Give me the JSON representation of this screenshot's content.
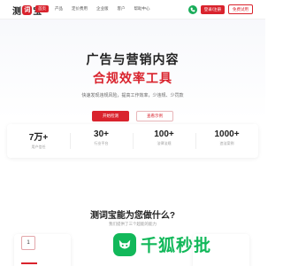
{
  "brand": {
    "logo_left": "测",
    "logo_mark": "词",
    "logo_right": "宝",
    "accent_color": "#d9232d",
    "phone_color": "#1aad5a"
  },
  "nav": {
    "items": [
      {
        "label": "首页",
        "active": true
      },
      {
        "label": "产品"
      },
      {
        "label": "定价费用"
      },
      {
        "label": "企业版"
      },
      {
        "label": "客户"
      },
      {
        "label": "帮助中心"
      }
    ],
    "login_label": "登录/注册",
    "trial_label": "免费试用"
  },
  "hero": {
    "title": "广告与营销内容",
    "title_highlight": "合规效率工具",
    "subtitle": "快速发现违规风险，提高工作效率，少违规、少罚款",
    "primary_button": "开始检测",
    "secondary_button": "查看示例"
  },
  "stats": [
    {
      "value": "7万+",
      "label": "用户信任"
    },
    {
      "value": "30+",
      "label": "行业平台"
    },
    {
      "value": "100+",
      "label": "法律法规"
    },
    {
      "value": "1000+",
      "label": "违法案例"
    }
  ],
  "section": {
    "title": "测词宝能为您做什么?",
    "subtitle": "我们提供了三个超能的能力"
  },
  "cards": [
    {
      "number": "1"
    }
  ],
  "watermark": {
    "text": "千狐秒批",
    "color": "#12b85a"
  }
}
